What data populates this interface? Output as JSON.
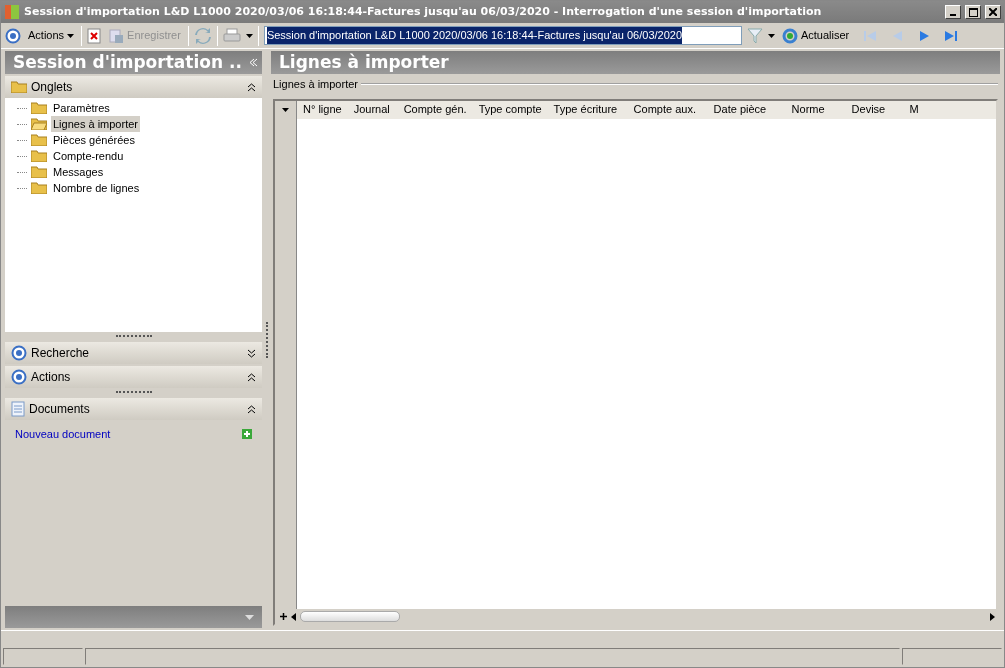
{
  "window": {
    "title": "Session d'importation L&D L1000 2020/03/06 16:18:44-Factures jusqu'au 06/03/2020 -  Interrogation d'une session d'importation"
  },
  "toolbar": {
    "actions_label": "Actions",
    "save": {
      "label": "Enregistrer",
      "disabled": true
    },
    "record_field": {
      "value": "Session d'importation L&D L1000 2020/03/06 16:18:44-Factures jusqu'au 06/03/2020",
      "selected": true
    },
    "refresh_label": "Actualiser",
    "nav": [
      {
        "kind": "first",
        "disabled": true
      },
      {
        "kind": "prev",
        "disabled": true
      },
      {
        "kind": "next",
        "disabled": false
      },
      {
        "kind": "last",
        "disabled": false
      }
    ]
  },
  "sidebar": {
    "title": "Session d'importation ..",
    "sections": [
      {
        "kind": "tabs",
        "title": "Onglets",
        "expanded": true,
        "items": [
          {
            "label": "Paramètres",
            "selected": false
          },
          {
            "label": "Lignes à importer",
            "selected": true
          },
          {
            "label": "Pièces générées",
            "selected": false
          },
          {
            "label": "Compte-rendu",
            "selected": false
          },
          {
            "label": "Messages",
            "selected": false
          },
          {
            "label": "Nombre de lignes",
            "selected": false
          }
        ]
      },
      {
        "kind": "radio",
        "title": "Recherche",
        "expanded": false
      },
      {
        "kind": "radio",
        "title": "Actions",
        "expanded": true
      },
      {
        "kind": "doc",
        "title": "Documents",
        "expanded": true,
        "link": "Nouveau document"
      }
    ]
  },
  "main": {
    "title": "Lignes à importer",
    "group_label": "Lignes à importer",
    "columns": [
      "N° ligne",
      "Journal",
      "Compte gén.",
      "Type compte",
      "Type écriture",
      "Compte aux.",
      "Date pièce",
      "Norme",
      "Devise",
      "M"
    ]
  }
}
